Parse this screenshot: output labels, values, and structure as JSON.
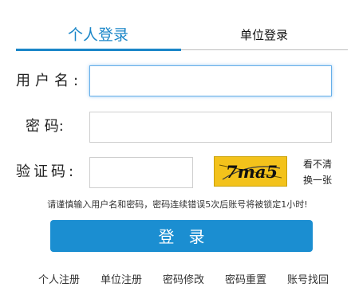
{
  "tabs": {
    "personal": "个人登录",
    "unit": "单位登录"
  },
  "form": {
    "username_label": "用户名:",
    "username_value": "",
    "password_label": "密 码:",
    "password_value": "",
    "captcha_label": "验证码:",
    "captcha_value": "",
    "captcha_text": "7ma5",
    "refresh_line1": "看不清",
    "refresh_line2": "换一张"
  },
  "notice": "请谨慎输入用户名和密码，密码连续错误5次后账号将被锁定1小时!",
  "login_button": "登录",
  "links": [
    "个人注册",
    "单位注册",
    "密码修改",
    "密码重置",
    "账号找回"
  ],
  "colors": {
    "accent": "#1a86c8",
    "button": "#1b8ed1",
    "captcha_bg": "#f3c21b"
  }
}
